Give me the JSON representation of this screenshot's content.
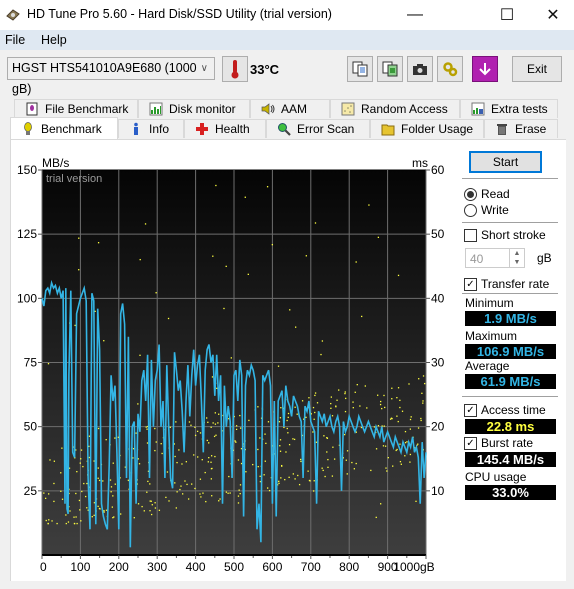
{
  "window": {
    "title": "HD Tune Pro 5.60 - Hard Disk/SSD Utility (trial version)",
    "controls": {
      "minimize": "—",
      "maximize": "☐",
      "close": "✕"
    }
  },
  "menu": {
    "items": [
      {
        "label": "File"
      },
      {
        "label": "Help"
      }
    ]
  },
  "toolbar": {
    "drive": "HGST HTS541010A9E680 (1000 gB)",
    "temperature": "33°C",
    "icons": [
      "copy-text-icon",
      "copy-screenshot-icon",
      "camera-icon",
      "options-icon",
      "save-icon"
    ],
    "exit_label": "Exit"
  },
  "tabs": {
    "row1": [
      {
        "label": "File Benchmark",
        "icon": "file-benchmark-icon"
      },
      {
        "label": "Disk monitor",
        "icon": "disk-monitor-icon"
      },
      {
        "label": "AAM",
        "icon": "speaker-icon"
      },
      {
        "label": "Random Access",
        "icon": "random-access-icon"
      },
      {
        "label": "Extra tests",
        "icon": "extra-tests-icon"
      }
    ],
    "row2": [
      {
        "label": "Benchmark",
        "icon": "bulb-icon",
        "active": true
      },
      {
        "label": "Info",
        "icon": "info-icon"
      },
      {
        "label": "Health",
        "icon": "health-cross-icon"
      },
      {
        "label": "Error Scan",
        "icon": "magnifier-icon"
      },
      {
        "label": "Folder Usage",
        "icon": "folder-icon"
      },
      {
        "label": "Erase",
        "icon": "trash-icon"
      }
    ]
  },
  "side": {
    "start_label": "Start",
    "read_label": "Read",
    "write_label": "Write",
    "mode": "Read",
    "short_stroke_label": "Short stroke",
    "short_stroke_checked": false,
    "short_stroke_value": "40",
    "short_stroke_unit": "gB",
    "transfer_rate_label": "Transfer rate",
    "transfer_rate_checked": true,
    "minimum_label": "Minimum",
    "minimum": "1.9 MB/s",
    "maximum_label": "Maximum",
    "maximum": "106.9 MB/s",
    "average_label": "Average",
    "average": "61.9 MB/s",
    "access_time_label": "Access time",
    "access_time_checked": true,
    "access_time": "22.8 ms",
    "burst_rate_label": "Burst rate",
    "burst_rate_checked": true,
    "burst_rate": "145.4 MB/s",
    "cpu_label": "CPU usage",
    "cpu": "33.0%",
    "colors": {
      "transfer": "#33b5e5",
      "access": "#ffff40",
      "cpu_text": "#ffffff"
    }
  },
  "chart_data": {
    "type": "line",
    "watermark": "trial version",
    "xlabel": "gB",
    "ylabel_left": "MB/s",
    "ylabel_right": "ms",
    "xlim": [
      0,
      1000
    ],
    "ylim_left": [
      0,
      150
    ],
    "ylim_right": [
      0,
      60
    ],
    "xticks": [
      "0",
      "100",
      "200",
      "300",
      "400",
      "500",
      "600",
      "700",
      "800",
      "900",
      "1000gB"
    ],
    "yticks_left": [
      "25",
      "50",
      "75",
      "100",
      "125",
      "150"
    ],
    "yticks_right": [
      "10",
      "20",
      "30",
      "40",
      "50",
      "60"
    ],
    "grid": true,
    "series": [
      {
        "name": "Transfer rate (MB/s)",
        "color": "#33b5e5",
        "x": [
          0,
          5,
          10,
          15,
          20,
          25,
          30,
          35,
          40,
          45,
          50,
          55,
          60,
          62,
          65,
          68,
          70,
          75,
          80,
          85,
          90,
          95,
          100,
          105,
          110,
          115,
          120,
          125,
          130,
          135,
          140,
          145,
          150,
          155,
          160,
          165,
          170,
          175,
          180,
          185,
          190,
          195,
          200,
          205,
          210,
          215,
          220,
          225,
          230,
          235,
          240,
          245,
          250,
          255,
          260,
          265,
          270,
          275,
          280,
          285,
          290,
          295,
          300,
          305,
          310,
          315,
          320,
          325,
          330,
          335,
          340,
          345,
          350,
          355,
          360,
          365,
          370,
          375,
          380,
          385,
          390,
          395,
          400,
          405,
          410,
          415,
          420,
          425,
          430,
          435,
          440,
          445,
          450,
          455,
          460,
          465,
          470,
          475,
          480,
          485,
          490,
          495,
          500,
          505,
          510,
          515,
          520,
          525,
          530,
          535,
          540,
          545,
          550,
          555,
          560,
          565,
          570,
          575,
          580,
          585,
          590,
          595,
          600,
          605,
          610,
          615,
          620,
          625,
          630,
          635,
          640,
          645,
          650,
          655,
          660,
          665,
          670,
          675,
          680,
          685,
          690,
          695,
          700,
          705,
          710,
          715,
          720,
          725,
          730,
          735,
          740,
          745,
          750,
          755,
          760,
          765,
          770,
          775,
          780,
          785,
          790,
          795,
          800,
          805,
          810,
          815,
          820,
          825,
          830,
          835,
          840,
          845,
          850,
          855,
          860,
          865,
          870,
          875,
          880,
          885,
          890,
          895,
          900,
          905,
          910,
          915,
          920,
          925,
          930,
          935,
          940,
          945,
          950,
          955,
          960,
          965,
          970,
          975,
          980,
          985,
          990,
          995,
          1000
        ],
        "values": [
          100,
          97,
          103,
          104,
          102,
          106,
          104,
          105,
          102,
          104,
          100,
          103,
          20,
          104,
          18,
          16,
          70,
          103,
          40,
          38,
          94,
          97,
          100,
          102,
          104,
          99,
          30,
          10,
          102,
          99,
          12,
          96,
          80,
          20,
          15,
          12,
          10,
          35,
          70,
          60,
          66,
          40,
          10,
          94,
          98,
          90,
          30,
          85,
          3,
          50,
          52,
          20,
          55,
          48,
          68,
          72,
          60,
          78,
          30,
          76,
          50,
          68,
          72,
          82,
          50,
          60,
          30,
          74,
          50,
          30,
          26,
          79,
          72,
          64,
          68,
          56,
          40,
          60,
          74,
          54,
          70,
          80,
          66,
          74,
          78,
          60,
          40,
          72,
          80,
          82,
          75,
          78,
          62,
          78,
          60,
          70,
          20,
          66,
          50,
          58,
          52,
          30,
          70,
          72,
          60,
          76,
          70,
          15,
          66,
          72,
          70,
          74,
          72,
          68,
          10,
          20,
          5,
          70,
          68,
          70,
          72,
          66,
          20,
          60,
          15,
          60,
          62,
          64,
          50,
          66,
          60,
          58,
          54,
          62,
          60,
          58,
          54,
          52,
          30,
          58,
          56,
          60,
          52,
          50,
          48,
          20,
          56,
          54,
          52,
          55,
          50,
          52,
          54,
          50,
          48,
          52,
          54,
          50,
          25,
          52,
          48,
          50,
          54,
          52,
          50,
          48,
          50,
          54,
          52,
          50,
          48,
          50,
          52,
          50,
          48,
          46,
          50,
          48,
          46,
          50,
          44,
          46,
          48,
          46,
          44,
          42,
          46,
          44,
          42,
          40,
          44,
          42,
          40,
          44,
          42,
          46,
          40,
          42,
          38,
          20,
          44,
          30,
          40
        ]
      },
      {
        "name": "Access time (ms)",
        "color": "#ffff40",
        "type": "scatter",
        "average_ms": 22.8,
        "range_ms": [
          5,
          58
        ]
      }
    ]
  }
}
